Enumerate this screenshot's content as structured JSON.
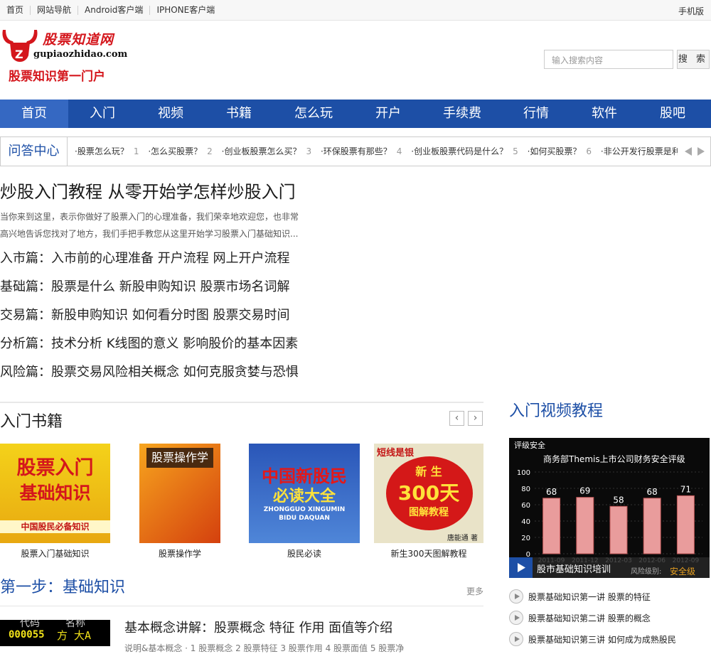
{
  "topbar": {
    "links": [
      "首页",
      "网站导航",
      "Android客户端",
      "IPHONE客户端"
    ],
    "mobile": "手机版"
  },
  "logo": {
    "name": "股票知道网",
    "domain": "gupiaozhidao.com",
    "slogan": "股票知识第一门户"
  },
  "search": {
    "placeholder": "输入搜索内容",
    "button": "搜 索"
  },
  "nav": [
    "首页",
    "入门",
    "视频",
    "书籍",
    "怎么玩",
    "开户",
    "手续费",
    "行情",
    "软件",
    "股吧"
  ],
  "qa": {
    "title": "问答中心",
    "items": [
      {
        "text": "股票怎么玩？",
        "num": "1"
      },
      {
        "text": "怎么买股票？",
        "num": "2"
      },
      {
        "text": "创业板股票怎么买？",
        "num": "3"
      },
      {
        "text": "环保股票有那些？",
        "num": "4"
      },
      {
        "text": "创业板股票代码是什么？",
        "num": "5"
      },
      {
        "text": "如何买股票？",
        "num": "6"
      },
      {
        "text": "非公开发行股票是利",
        "num": ""
      }
    ]
  },
  "intro": {
    "title": "炒股入门教程 从零开始学怎样炒股入门",
    "desc": "当你来到这里，表示你做好了股票入门的心理准备，我们荣幸地欢迎您，也非常高兴地告诉您找对了地方，我们手把手教您从这里开始学习股票入门基础知识...",
    "categories": [
      {
        "label": "入市篇：",
        "links": "入市前的心理准备 开户流程 网上开户流程"
      },
      {
        "label": "基础篇：",
        "links": "股票是什么 新股申购知识 股票市场名词解"
      },
      {
        "label": "交易篇：",
        "links": "新股申购知识 如何看分时图 股票交易时间"
      },
      {
        "label": "分析篇：",
        "links": "技术分析 K线图的意义 影响股价的基本因素"
      },
      {
        "label": "风险篇：",
        "links": "股票交易风险相关概念 如何克服贪婪与恐惧"
      }
    ]
  },
  "books": {
    "title": "入门书籍",
    "items": [
      {
        "caption": "股票入门基础知识",
        "cover_l1": "股票入门",
        "cover_l2": "基础知识",
        "cover_l3": "中国股民必备知识"
      },
      {
        "caption": "股票操作学",
        "cover_l1": "股票操作学"
      },
      {
        "caption": "股民必读",
        "cover_l1": "中国新股民",
        "cover_l2": "必读大全",
        "cover_l3": "ZHONGGUO XINGUMIN",
        "cover_l4": "BIDU DAQUAN"
      },
      {
        "caption": "新生300天图解教程",
        "cover_l0": "短线是银",
        "cover_l1": "新 生",
        "cover_l2": "300天",
        "cover_l3": "图解教程",
        "cover_l4": "唐能通 著"
      }
    ]
  },
  "step": {
    "title": "第一步：基础知识",
    "more": "更多",
    "headline": "基本概念讲解：股票概念 特征 作用 面值等介绍",
    "sub": "说明&基本概念 · 1 股票概念 2 股票特征 3 股票作用 4 股票面值 5 股票净",
    "ticker_code_label": "代码",
    "ticker_name_label": "名称",
    "ticker_code": "000055",
    "ticker_name": "方 大A"
  },
  "video": {
    "title": "入门视频教程",
    "chart": {
      "corner": "评级安全",
      "title": "商务部Themis上市公司财务安全评级",
      "yticks": [
        "100",
        "80",
        "60",
        "40",
        "20",
        "0"
      ],
      "values": [
        68,
        69,
        58,
        68,
        71
      ],
      "xlabels": [
        "2011-09",
        "2011-12",
        "2012-03",
        "2012-06",
        "2012-09"
      ],
      "footer_risk": "风险级别:",
      "footer_safe": "安全级"
    },
    "chart_data": {
      "type": "bar",
      "title": "商务部Themis上市公司财务安全评级",
      "categories": [
        "2011-09",
        "2011-12",
        "2012-03",
        "2012-06",
        "2012-09"
      ],
      "values": [
        68,
        69,
        58,
        68,
        71
      ],
      "ylim": [
        0,
        100
      ]
    },
    "play_label": "股市基础知识培训",
    "list": [
      "股票基础知识第一讲 股票的特征",
      "股票基础知识第二讲 股票的概念",
      "股票基础知识第三讲 如何成为成熟股民"
    ],
    "colors": {
      "brand": "#1d4fa6",
      "accent": "#d4161c"
    }
  }
}
